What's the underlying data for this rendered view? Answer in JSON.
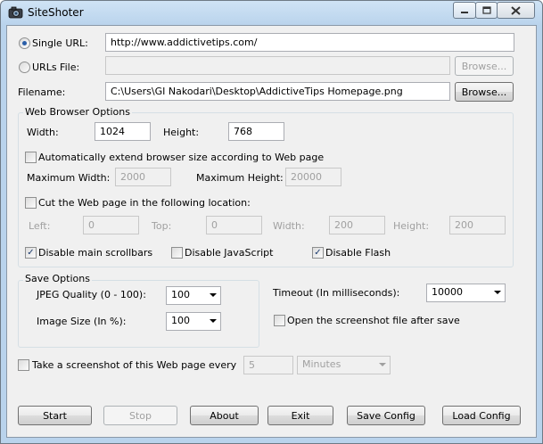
{
  "window": {
    "title": "SiteShoter"
  },
  "source": {
    "single_url_label": "Single URL:",
    "single_url_value": "http://www.addictivetips.com/",
    "urls_file_label": "URLs File:",
    "urls_file_value": "",
    "browse1_label": "Browse...",
    "filename_label": "Filename:",
    "filename_value": "C:\\Users\\GI Nakodari\\Desktop\\AddictiveTips Homepage.png",
    "browse2_label": "Browse..."
  },
  "browser": {
    "group_title": "Web Browser Options",
    "width_label": "Width:",
    "width_value": "1024",
    "height_label": "Height:",
    "height_value": "768",
    "auto_extend_label": "Automatically extend browser size according to Web page",
    "max_width_label": "Maximum Width:",
    "max_width_value": "2000",
    "max_height_label": "Maximum Height:",
    "max_height_value": "20000",
    "cut_label": "Cut the Web page in the following location:",
    "left_label": "Left:",
    "left_value": "0",
    "top_label": "Top:",
    "top_value": "0",
    "cut_width_label": "Width:",
    "cut_width_value": "200",
    "cut_height_label": "Height:",
    "cut_height_value": "200",
    "disable_scrollbars_label": "Disable main scrollbars",
    "disable_js_label": "Disable JavaScript",
    "disable_flash_label": "Disable Flash"
  },
  "save": {
    "group_title": "Save Options",
    "jpeg_label": "JPEG Quality (0 - 100):",
    "jpeg_value": "100",
    "size_label": "Image Size (In %):",
    "size_value": "100",
    "timeout_label": "Timeout (In milliseconds):",
    "timeout_value": "10000",
    "open_after_label": "Open the screenshot file after save"
  },
  "schedule": {
    "label": "Take a screenshot of this Web page every",
    "interval_value": "5",
    "unit_value": "Minutes"
  },
  "buttons": {
    "start": "Start",
    "stop": "Stop",
    "about": "About",
    "exit": "Exit",
    "save_config": "Save Config",
    "load_config": "Load Config"
  },
  "checkmark": "✓"
}
